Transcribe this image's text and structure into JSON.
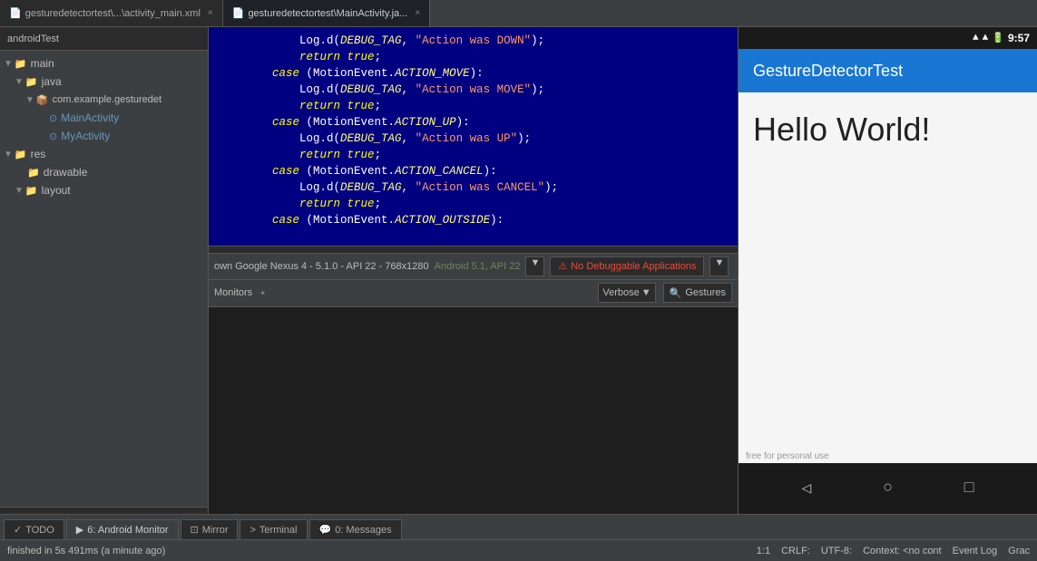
{
  "tabs": {
    "inactive1": {
      "label": "gesturedetectortest\\...\\activity_main.xml",
      "close": "×"
    },
    "active1": {
      "label": "gesturedetectortest\\MainActivity.ja...",
      "close": "×"
    }
  },
  "project_tree": {
    "root": "androidTest",
    "items": [
      {
        "label": "main",
        "level": 0,
        "type": "folder",
        "expanded": true
      },
      {
        "label": "java",
        "level": 1,
        "type": "folder",
        "expanded": true
      },
      {
        "label": "com.example.gesturedet",
        "level": 2,
        "type": "package",
        "expanded": true
      },
      {
        "label": "MainActivity",
        "level": 3,
        "type": "activity"
      },
      {
        "label": "MyActivity",
        "level": 3,
        "type": "activity"
      },
      {
        "label": "res",
        "level": 1,
        "type": "folder",
        "expanded": true
      },
      {
        "label": "drawable",
        "level": 2,
        "type": "folder"
      },
      {
        "label": "layout",
        "level": 2,
        "type": "folder",
        "expanded": true
      }
    ]
  },
  "code_editor": {
    "lines": [
      "            Log.d(DEBUG_TAG, \"Action was DOWN\");",
      "            return true;",
      "        case (MotionEvent.ACTION_MOVE):",
      "            Log.d(DEBUG_TAG, \"Action was MOVE\");",
      "            return true;",
      "        case (MotionEvent.ACTION_UP):",
      "            Log.d(DEBUG_TAG, \"Action was UP\");",
      "            return true;",
      "        case (MotionEvent.ACTION_CANCEL):",
      "            Log.d(DEBUG_TAG, \"Action was CANCEL\");",
      "            return true;",
      "        case (MotionEvent.ACTION_OUTSIDE):"
    ]
  },
  "device_bar": {
    "device_label": "own Google Nexus 4 - 5.1.0 - API 22 - 768x1280",
    "android_label": "Android 5.1, API 22",
    "no_debug": "No Debuggable Applications",
    "dropdown_arrow": "▼"
  },
  "monitor_bar": {
    "label": "Monitors",
    "pin": "✦",
    "verbose_label": "Verbose",
    "dropdown_arrow": "▼",
    "search_icon": "🔍",
    "search_label": "Gestures"
  },
  "emulator": {
    "status_bar": {
      "time": "9:57",
      "wifi": "▲",
      "signal": "▲",
      "battery": "■"
    },
    "app_title": "GestureDetectorTest",
    "hello_world": "Hello World!",
    "nav": {
      "back": "◁",
      "home": "○",
      "recent": "□"
    },
    "watermark": "free for personal use"
  },
  "bottom_tabs": [
    {
      "label": "TODO",
      "icon": "✓"
    },
    {
      "label": "6: Android Monitor",
      "icon": "▶",
      "active": true
    },
    {
      "label": "Mirror",
      "icon": "⊡"
    },
    {
      "label": "Terminal",
      "icon": ">"
    },
    {
      "label": "0: Messages",
      "icon": "💬"
    }
  ],
  "status_bar": {
    "left": "finished in 5s 491ms (a minute ago)",
    "position": "1:1",
    "line_ending": "CRLF:",
    "encoding": "UTF-8:",
    "context": "Context: <no cont",
    "right_tabs": [
      "Event Log",
      "Grac"
    ]
  }
}
